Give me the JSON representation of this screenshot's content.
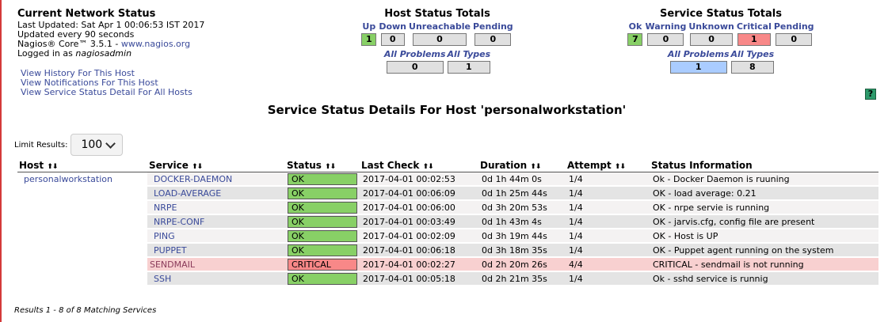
{
  "network_status": {
    "title": "Current Network Status",
    "last_updated": "Last Updated: Sat Apr 1 00:06:53 IST 2017",
    "update_interval": "Updated every 90 seconds",
    "version_prefix": "Nagios® Core™ 3.5.1 - ",
    "version_link": "www.nagios.org",
    "logged_in_prefix": "Logged in as ",
    "user": "nagiosadmin"
  },
  "nav_links": [
    "View History For This Host",
    "View Notifications For This Host",
    "View Service Status Detail For All Hosts"
  ],
  "host_totals": {
    "title": "Host Status Totals",
    "labels": [
      "Up",
      "Down",
      "Unreachable",
      "Pending"
    ],
    "values": [
      "1",
      "0",
      "0",
      "0"
    ],
    "all_problems_label": "All Problems",
    "all_types_label": "All Types",
    "all_problems": "0",
    "all_types": "1"
  },
  "service_totals": {
    "title": "Service Status Totals",
    "labels": [
      "Ok",
      "Warning",
      "Unknown",
      "Critical",
      "Pending"
    ],
    "values": [
      "7",
      "0",
      "0",
      "1",
      "0"
    ],
    "all_problems_label": "All Problems",
    "all_types_label": "All Types",
    "all_problems": "1",
    "all_types": "8"
  },
  "help_icon": "?",
  "page_title": "Service Status Details For Host 'personalworkstation'",
  "limit": {
    "label": "Limit Results:",
    "value": "100"
  },
  "columns": [
    "Host",
    "Service",
    "Status",
    "Last Check",
    "Duration",
    "Attempt",
    "Status Information"
  ],
  "sort_glyph": "⬆⬇",
  "host_name": "personalworkstation",
  "services": [
    {
      "service": "DOCKER-DAEMON",
      "status": "OK",
      "last_check": "2017-04-01 00:02:53",
      "duration": "0d 1h 44m 0s",
      "attempt": "1/4",
      "info": "Ok - Docker Daemon is ruuning"
    },
    {
      "service": "LOAD-AVERAGE",
      "status": "OK",
      "last_check": "2017-04-01 00:06:09",
      "duration": "0d 1h 25m 44s",
      "attempt": "1/4",
      "info": "OK - load average: 0.21"
    },
    {
      "service": "NRPE",
      "status": "OK",
      "last_check": "2017-04-01 00:06:00",
      "duration": "0d 3h 20m 53s",
      "attempt": "1/4",
      "info": "OK - nrpe servie is running"
    },
    {
      "service": "NRPE-CONF",
      "status": "OK",
      "last_check": "2017-04-01 00:03:49",
      "duration": "0d 1h 43m 4s",
      "attempt": "1/4",
      "info": "OK - jarvis.cfg, config file are present"
    },
    {
      "service": "PING",
      "status": "OK",
      "last_check": "2017-04-01 00:02:09",
      "duration": "0d 3h 19m 44s",
      "attempt": "1/4",
      "info": "OK - Host is UP"
    },
    {
      "service": "PUPPET",
      "status": "OK",
      "last_check": "2017-04-01 00:06:18",
      "duration": "0d 3h 18m 35s",
      "attempt": "1/4",
      "info": "OK - Puppet agent running on the system"
    },
    {
      "service": "SENDMAIL",
      "status": "CRITICAL",
      "last_check": "2017-04-01 00:02:27",
      "duration": "0d 2h 20m 26s",
      "attempt": "4/4",
      "info": "CRITICAL - sendmail is not running"
    },
    {
      "service": "SSH",
      "status": "OK",
      "last_check": "2017-04-01 00:05:18",
      "duration": "0d 2h 21m 35s",
      "attempt": "1/4",
      "info": "Ok - sshd service is runnig"
    }
  ],
  "results_text": "Results 1 - 8 of 8 Matching Services",
  "colors": {
    "ok": "#88d066",
    "critical": "#f88888",
    "problems": "#aaccff",
    "link": "#3a4a9a"
  }
}
